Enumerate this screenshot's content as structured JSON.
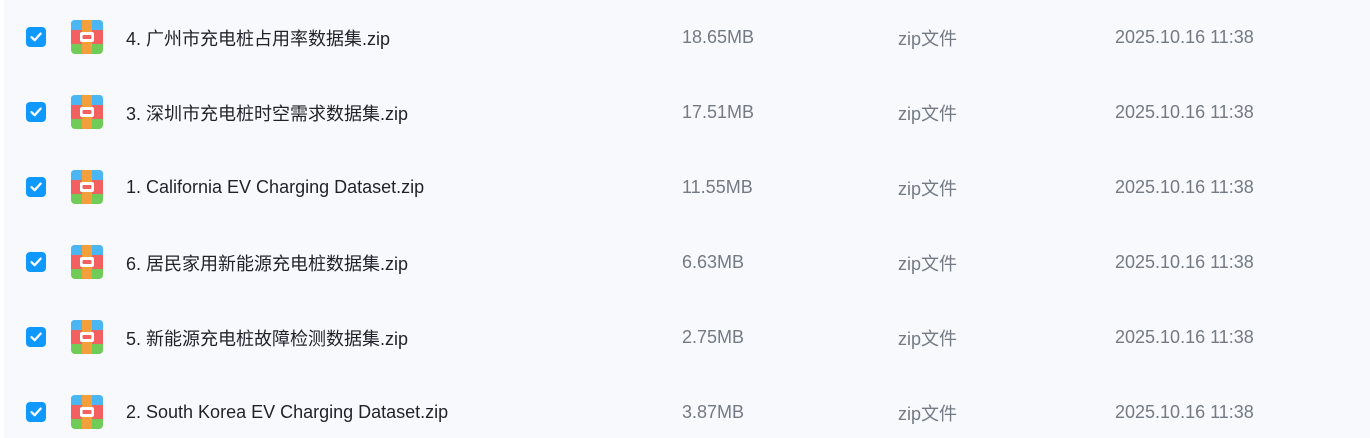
{
  "files": [
    {
      "name": "4. 广州市充电桩占用率数据集.zip",
      "size": "18.65MB",
      "type": "zip文件",
      "modified": "2025.10.16 11:38",
      "checked": true
    },
    {
      "name": "3. 深圳市充电桩时空需求数据集.zip",
      "size": "17.51MB",
      "type": "zip文件",
      "modified": "2025.10.16 11:38",
      "checked": true
    },
    {
      "name": "1. California EV Charging Dataset.zip",
      "size": "11.55MB",
      "type": "zip文件",
      "modified": "2025.10.16 11:38",
      "checked": true
    },
    {
      "name": "6. 居民家用新能源充电桩数据集.zip",
      "size": "6.63MB",
      "type": "zip文件",
      "modified": "2025.10.16 11:38",
      "checked": true
    },
    {
      "name": "5. 新能源充电桩故障检测数据集.zip",
      "size": "2.75MB",
      "type": "zip文件",
      "modified": "2025.10.16 11:38",
      "checked": true
    },
    {
      "name": "2. South Korea EV Charging Dataset.zip",
      "size": "3.87MB",
      "type": "zip文件",
      "modified": "2025.10.16 11:38",
      "checked": true
    }
  ],
  "icons": {
    "checkbox": "checkmark-icon",
    "file": "zip-archive-icon"
  },
  "colors": {
    "checkbox": "#0f99ff",
    "background": "#f7f9fc",
    "text_primary": "#1f2329",
    "text_secondary": "#747a84",
    "archive_top": "#4bb7f2",
    "archive_middle": "#f26060",
    "archive_bottom": "#70cc57",
    "archive_zipper": "#f3a03c"
  }
}
